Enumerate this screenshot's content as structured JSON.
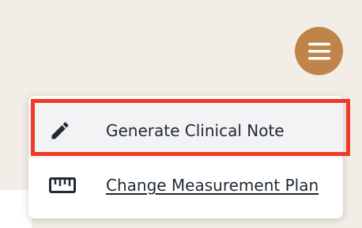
{
  "header": {
    "menu_button_icon": "hamburger-menu-icon",
    "menu_button_color": "#c0844a"
  },
  "dropdown": {
    "items": [
      {
        "label": "Generate Clinical Note",
        "icon": "pencil-icon",
        "highlighted": true
      },
      {
        "label": "Change Measurement Plan",
        "icon": "ruler-icon",
        "underlined": true
      }
    ],
    "highlight_color": "#f03a24"
  }
}
